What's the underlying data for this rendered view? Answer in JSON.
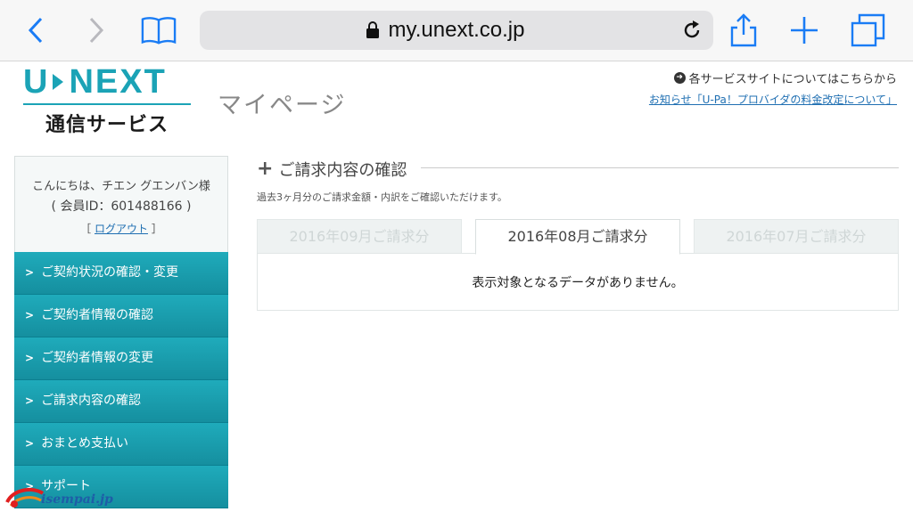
{
  "browser": {
    "url": "my.unext.co.jp",
    "icons": [
      "back-icon",
      "forward-icon",
      "bookmarks-icon",
      "lock-icon",
      "reload-icon",
      "share-icon",
      "new-tab-icon",
      "tabs-icon"
    ]
  },
  "header": {
    "logo_u": "U",
    "logo_next": "NEXT",
    "logo_sub": "通信サービス",
    "page_title": "マイページ",
    "service_link": "各サービスサイトについてはこちらから",
    "notice_link": "お知らせ「U-Pa！プロバイダの料金改定について」"
  },
  "sidebar": {
    "greeting": "こんにちは、チエン グエンバン様",
    "member_id": "( 会員ID：601488166 )",
    "logout_open": "［",
    "logout_label": "ログアウト",
    "logout_close": "］",
    "items": [
      {
        "label": "ご契約状況の確認・変更"
      },
      {
        "label": "ご契約者情報の確認"
      },
      {
        "label": "ご契約者情報の変更"
      },
      {
        "label": "ご請求内容の確認"
      },
      {
        "label": "おまとめ支払い"
      },
      {
        "label": "サポート"
      }
    ]
  },
  "main": {
    "section_title": "ご請求内容の確認",
    "description": "過去3ヶ月分のご請求金額・内訳をご確認いただけます。",
    "tabs": [
      {
        "label": "2016年09月ご請求分",
        "active": false
      },
      {
        "label": "2016年08月ご請求分",
        "active": true
      },
      {
        "label": "2016年07月ご請求分",
        "active": false
      }
    ],
    "empty_message": "表示対象となるデータがありません。"
  },
  "watermark": {
    "text": "isempai.jp"
  },
  "colors": {
    "brand": "#1ba3b6",
    "menu": "#1a9dad",
    "link": "#1f6fb2"
  }
}
